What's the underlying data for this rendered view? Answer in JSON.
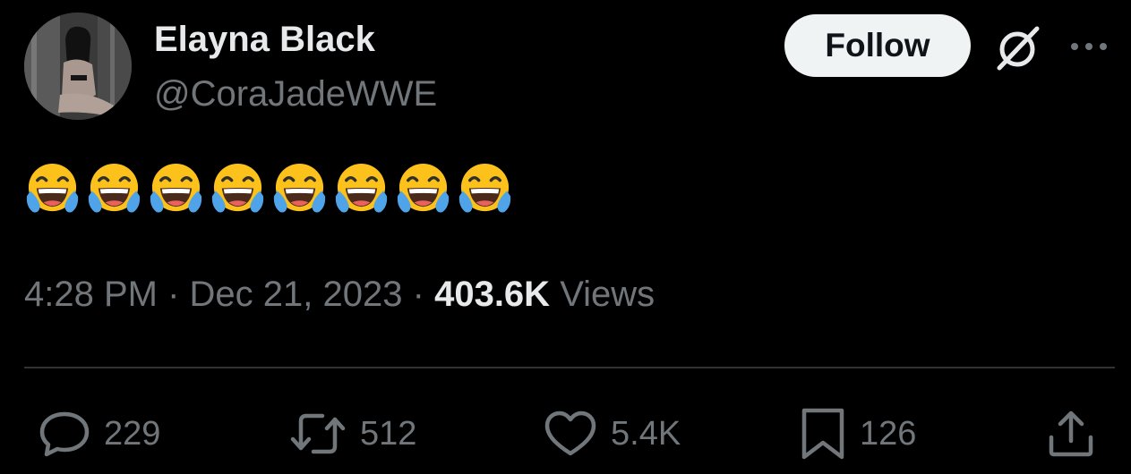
{
  "author": {
    "display_name": "Elayna Black",
    "handle": "@CoraJadeWWE"
  },
  "header": {
    "follow_label": "Follow",
    "grok_icon": "grok-icon",
    "more_icon": "more-options-icon"
  },
  "tweet": {
    "text": "😂😂😂😂😂😂😂😂",
    "emoji_count": 8,
    "emoji_name": "face-with-tears-of-joy"
  },
  "meta": {
    "time": "4:28 PM",
    "separator": "·",
    "date": "Dec 21, 2023",
    "views_count": "403.6K",
    "views_label": "Views"
  },
  "actions": {
    "replies": {
      "icon": "reply-icon",
      "count": "229"
    },
    "reposts": {
      "icon": "repost-icon",
      "count": "512"
    },
    "likes": {
      "icon": "heart-icon",
      "count": "5.4K"
    },
    "bookmarks": {
      "icon": "bookmark-icon",
      "count": "126"
    },
    "share": {
      "icon": "share-icon"
    }
  },
  "colors": {
    "background": "#000000",
    "primary_text": "#e7e9ea",
    "secondary_text": "#71767b",
    "follow_button_bg": "#eff3f4",
    "follow_button_text": "#0f1419",
    "divider": "#2f3336"
  }
}
